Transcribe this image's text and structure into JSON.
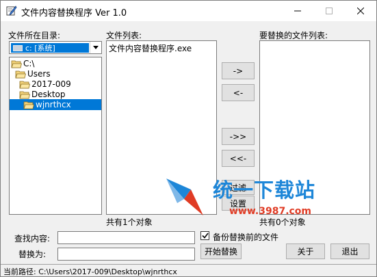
{
  "window": {
    "title": "文件内容替换程序 Ver 1.0"
  },
  "labels": {
    "dir_label": "文件所在目录:",
    "file_list_label": "文件列表:",
    "replace_list_label": "要替换的文件列表:",
    "file_count": "共有1个对象",
    "replace_count": "共有0个对象",
    "find_label": "查找内容:",
    "replace_label": "替换为:"
  },
  "drive_combo": {
    "selected": "c: [系统]"
  },
  "directory_tree": [
    {
      "label": "C:\\",
      "selected": false
    },
    {
      "label": "Users",
      "selected": false
    },
    {
      "label": "2017-009",
      "selected": false
    },
    {
      "label": "Desktop",
      "selected": false
    },
    {
      "label": "wjnrthcx",
      "selected": true
    }
  ],
  "file_list": [
    "文件内容替换程序.exe"
  ],
  "replace_list": [],
  "buttons": {
    "add_one": "->",
    "remove_one": "<-",
    "add_all": "->>",
    "remove_all": "<<-",
    "filter": "过滤",
    "settings": "设置",
    "start_replace": "开始替换",
    "about": "关于",
    "exit": "退出"
  },
  "find_input": {
    "value": ""
  },
  "replace_input": {
    "value": ""
  },
  "backup_checkbox": {
    "label": "备份替换前的文件",
    "checked": true
  },
  "status_bar": {
    "text": "当前路径: C:\\Users\\2017-009\\Desktop\\wjnrthcx"
  },
  "watermark": {
    "text": "统一下载站",
    "url": "www.3987.com"
  },
  "colors": {
    "selection": "#0078d7",
    "window_bg": "#f0f0f0",
    "watermark_blue": "#1d86d8",
    "watermark_red": "#e03b24"
  }
}
